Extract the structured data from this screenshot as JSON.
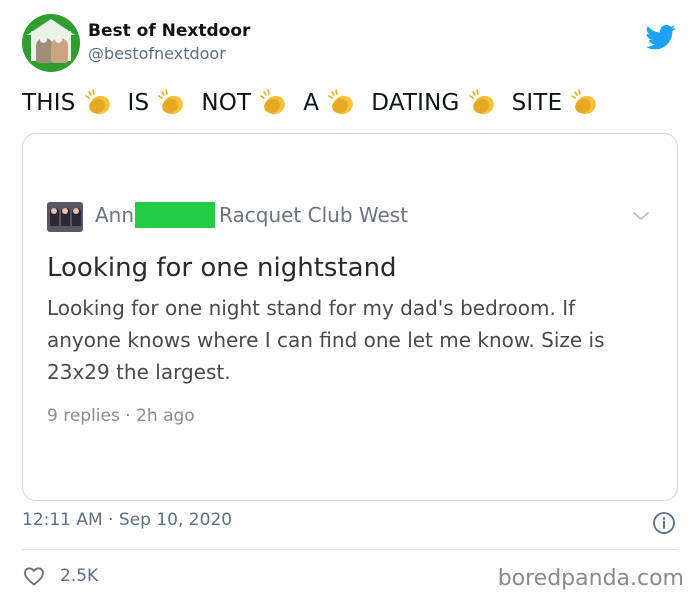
{
  "account": {
    "display_name": "Best of Nextdoor",
    "handle": "@bestofnextdoor",
    "avatar_icon": "nextdoor-house-icon",
    "platform_icon": "twitter-bird-icon",
    "platform_color": "#1da1f2"
  },
  "tweet": {
    "words": [
      "THIS",
      "IS",
      "NOT",
      "A",
      "DATING",
      "SITE"
    ],
    "emoji_icon": "clapping-hands-icon"
  },
  "embedded_post": {
    "author_prefix": "Ann",
    "author_redacted": true,
    "redaction_color": "#22cc44",
    "neighborhood": "Racquet Club West",
    "title": "Looking for one nightstand",
    "body": "Looking for one night stand for my dad's bedroom. If anyone knows where I can find one let me know. Size is 23x29 the largest.",
    "replies": "9 replies",
    "separator": "·",
    "age": "2h ago"
  },
  "footer": {
    "time": "12:11 AM",
    "separator": "·",
    "date": "Sep 10, 2020",
    "likes": "2.5K",
    "watermark": "boredpanda.com"
  }
}
